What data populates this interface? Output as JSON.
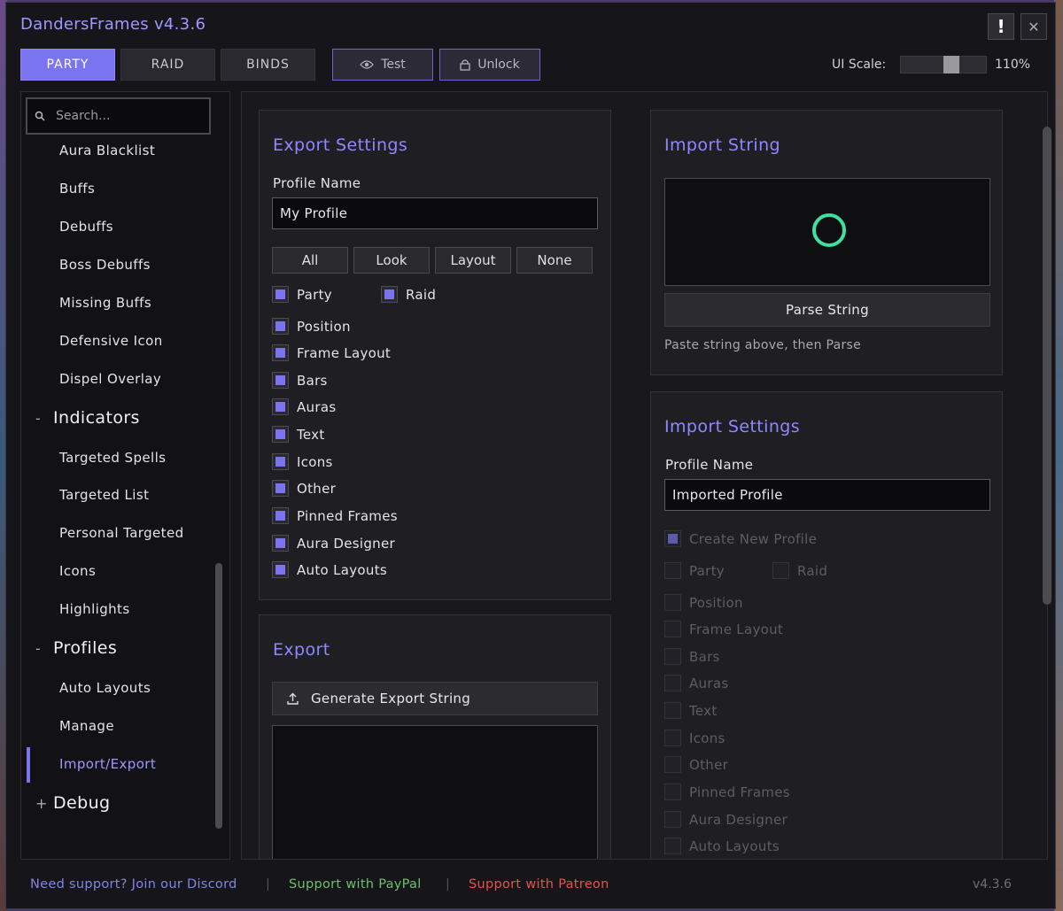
{
  "app": {
    "title": "DandersFrames v4.3.6",
    "alert_label": "!",
    "close_label": "✕"
  },
  "tabs": [
    {
      "label": "PARTY",
      "active": true
    },
    {
      "label": "RAID",
      "active": false
    },
    {
      "label": "BINDS",
      "active": false
    }
  ],
  "toolbar": {
    "test_label": "Test",
    "unlock_label": "Unlock",
    "ui_scale_label": "UI Scale:",
    "ui_scale_value": "110%",
    "ui_scale_level": 0.5
  },
  "sidebar": {
    "search_placeholder": "Search...",
    "items": [
      "Aura Blacklist",
      "Buffs",
      "Debuffs",
      "Boss Debuffs",
      "Missing Buffs",
      "Defensive Icon",
      "Dispel Overlay"
    ],
    "indicators": {
      "sign": "-",
      "label": "Indicators",
      "items": [
        "Targeted Spells",
        "Targeted List",
        "Personal Targeted",
        "Icons",
        "Highlights"
      ]
    },
    "profiles": {
      "sign": "-",
      "label": "Profiles",
      "items": [
        "Auto Layouts",
        "Manage",
        "Import/Export"
      ],
      "active_item": "Import/Export"
    },
    "debug": {
      "sign": "+",
      "label": "Debug"
    }
  },
  "export_settings": {
    "title": "Export Settings",
    "profile_name_label": "Profile Name",
    "profile_name_value": "My Profile",
    "select_buttons": [
      "All",
      "Look",
      "Layout",
      "None"
    ],
    "party_label": "Party",
    "raid_label": "Raid",
    "options": [
      "Position",
      "Frame Layout",
      "Bars",
      "Auras",
      "Text",
      "Icons",
      "Other",
      "Pinned Frames",
      "Aura Designer",
      "Auto Layouts"
    ]
  },
  "export": {
    "title": "Export",
    "generate_label": "Generate Export String"
  },
  "import_string": {
    "title": "Import String",
    "parse_label": "Parse String",
    "hint": "Paste string above, then Parse"
  },
  "import_settings": {
    "title": "Import Settings",
    "profile_name_label": "Profile Name",
    "profile_name_value": "Imported Profile",
    "create_new_label": "Create New Profile",
    "party_label": "Party",
    "raid_label": "Raid",
    "options": [
      "Position",
      "Frame Layout",
      "Bars",
      "Auras",
      "Text",
      "Icons",
      "Other",
      "Pinned Frames",
      "Aura Designer",
      "Auto Layouts"
    ]
  },
  "footer": {
    "discord": "Need support? Join our Discord",
    "paypal": "Support with PayPal",
    "patreon": "Support with Patreon",
    "separator": "|",
    "version": "v4.3.6"
  },
  "colors": {
    "accent": "#7b74f0",
    "discord": "#7f86e6",
    "paypal": "#6cc06c",
    "patreon": "#e8524a",
    "spinner": "#3ee0a0"
  }
}
